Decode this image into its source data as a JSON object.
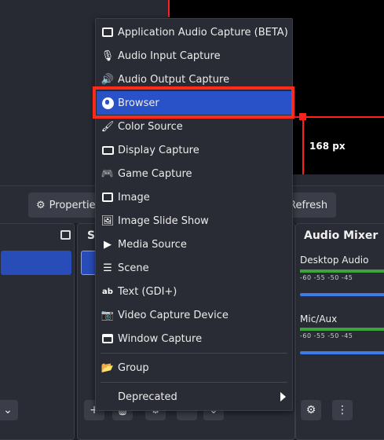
{
  "preview": {
    "size_label": "168 px"
  },
  "toolbar": {
    "properties_label": "Properties",
    "refresh_label": "Refresh"
  },
  "docks": {
    "sources_title": "So",
    "mixer_title": "Audio Mixer"
  },
  "mixer": {
    "channels": [
      {
        "name": "Desktop Audio",
        "ticks": "-60  -55  -50  -45"
      },
      {
        "name": "Mic/Aux",
        "ticks": "-60  -55  -50  -45"
      }
    ]
  },
  "menu": {
    "items": [
      {
        "label": "Application Audio Capture (BETA)",
        "icon": "app-audio-icon"
      },
      {
        "label": "Audio Input Capture",
        "icon": "microphone-icon"
      },
      {
        "label": "Audio Output Capture",
        "icon": "speaker-icon"
      },
      {
        "label": "Browser",
        "icon": "globe-icon",
        "selected": true
      },
      {
        "label": "Color Source",
        "icon": "brush-icon"
      },
      {
        "label": "Display Capture",
        "icon": "monitor-icon"
      },
      {
        "label": "Game Capture",
        "icon": "gamepad-icon"
      },
      {
        "label": "Image",
        "icon": "image-icon"
      },
      {
        "label": "Image Slide Show",
        "icon": "slideshow-icon"
      },
      {
        "label": "Media Source",
        "icon": "play-icon"
      },
      {
        "label": "Scene",
        "icon": "list-icon"
      },
      {
        "label": "Text (GDI+)",
        "icon": "text-icon"
      },
      {
        "label": "Video Capture Device",
        "icon": "camera-icon"
      },
      {
        "label": "Window Capture",
        "icon": "window-icon"
      }
    ],
    "group_label": "Group",
    "deprecated_label": "Deprecated"
  },
  "colors": {
    "selection": "#2a52c8",
    "highlight_border": "#ff2a1a",
    "background": "#1d1f26",
    "panel": "#2a2c35"
  }
}
